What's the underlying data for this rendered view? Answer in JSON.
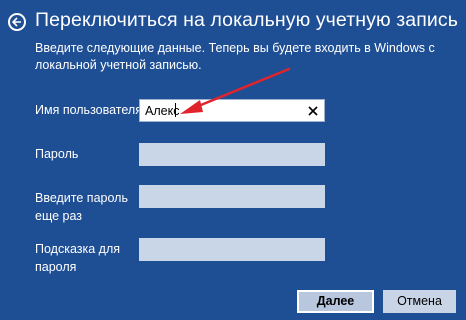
{
  "header": {
    "title": "Переключиться на локальную учетную запись",
    "back_icon": "back-arrow-icon"
  },
  "subtitle": "Введите следующие данные. Теперь вы будете входить в Windows с локальной учетной записью.",
  "form": {
    "username_label": "Имя пользователя",
    "username_value": "Алекс",
    "password_label": "Пароль",
    "password_value": "",
    "confirm_label_line1": "Введите пароль",
    "confirm_label_line2": "еще раз",
    "confirm_value": "",
    "hint_label_line1": "Подсказка для",
    "hint_label_line2": "пароля",
    "hint_value": ""
  },
  "buttons": {
    "next_label": "Далее",
    "cancel_label": "Отмена"
  },
  "colors": {
    "background": "#1e4e94",
    "annotation_arrow": "#e0242b"
  }
}
